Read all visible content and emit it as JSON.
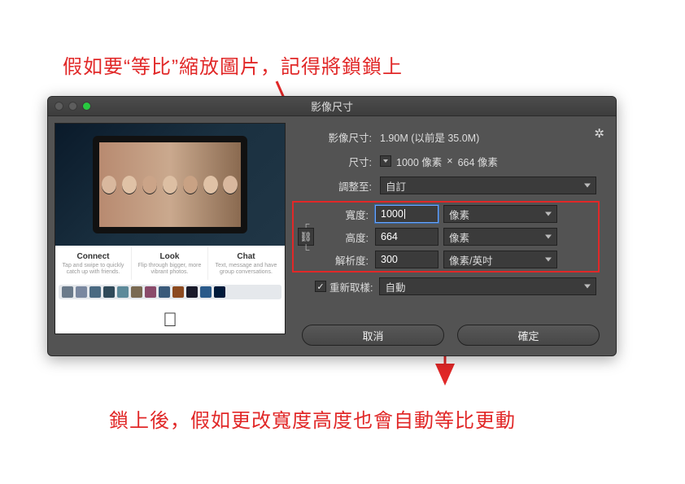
{
  "annotation": {
    "top": "假如要“等比”縮放圖片，記得將鎖鎖上",
    "bottom": "鎖上後，假如更改寬度高度也會自動等比更動"
  },
  "dialog": {
    "title": "影像尺寸",
    "info_label": "影像尺寸:",
    "info_value": "1.90M (以前是 35.0M)",
    "dimensions_label": "尺寸:",
    "dimensions_value_w": "1000 像素",
    "dimensions_x": "×",
    "dimensions_value_h": "664 像素",
    "fit_label": "調整至:",
    "fit_value": "自訂",
    "width_label": "寬度:",
    "width_value": "1000",
    "width_unit": "像素",
    "height_label": "高度:",
    "height_value": "664",
    "height_unit": "像素",
    "resolution_label": "解析度:",
    "resolution_value": "300",
    "resolution_unit": "像素/英吋",
    "resample_label": "重新取樣:",
    "resample_value": "自動",
    "cancel": "取消",
    "ok": "確定"
  },
  "preview": {
    "feat1": "Connect",
    "feat1_sub": "Tap and swipe to quickly catch up with friends.",
    "feat2": "Look",
    "feat2_sub": "Flip through bigger, more vibrant photos.",
    "feat3": "Chat",
    "feat3_sub": "Text, message and have group conversations."
  }
}
